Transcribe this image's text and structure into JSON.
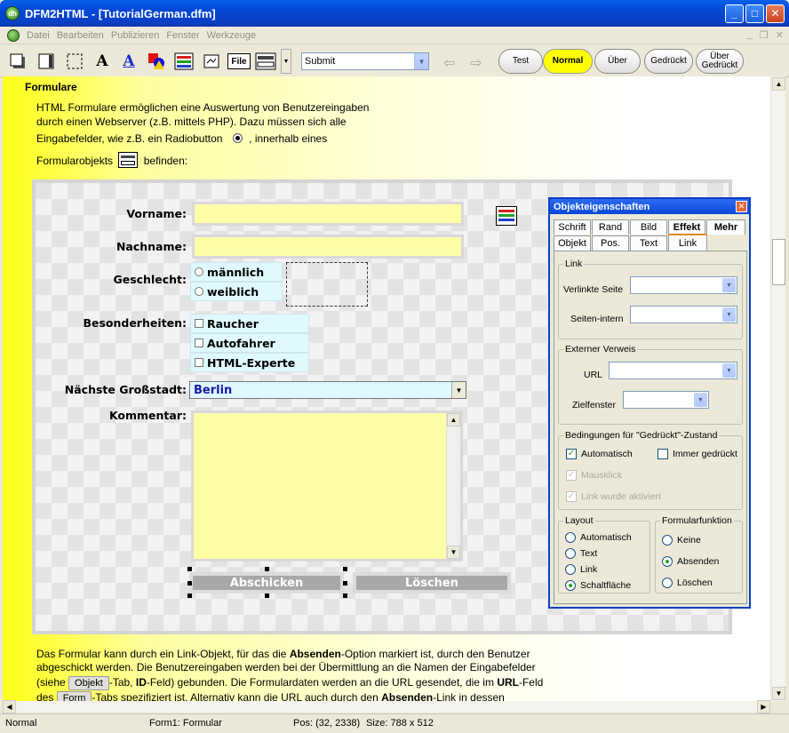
{
  "window": {
    "title": "DFM2HTML - [TutorialGerman.dfm]",
    "app_icon_label": "dh"
  },
  "menu": {
    "items": [
      "Datei",
      "Bearbeiten",
      "Publizieren",
      "Fenster",
      "Werkzeuge"
    ]
  },
  "toolbar": {
    "text_tool": "A",
    "text_tool_blue": "A",
    "file_label": "File",
    "combo_value": "Submit",
    "state_buttons": [
      "Test",
      "Normal",
      "Über",
      "Gedrückt",
      "Über Gedrückt"
    ]
  },
  "doc": {
    "heading": "Formulare",
    "intro_1": "HTML Formulare ermöglichen eine Auswertung von Benutzereingaben",
    "intro_2": "durch einen Webserver (z.B. mittels PHP). Dazu müssen sich alle",
    "intro_3a": "Eingabefelder, wie z.B. ein Radiobutton",
    "intro_3b": ", innerhalb eines",
    "intro_4a": "Formularobjekts",
    "intro_4b": "befinden:",
    "outro_1a": "Das Formular kann durch ein Link-Objekt, für das die",
    "outro_1b": "Absenden",
    "outro_1c": "-Option markiert ist, durch den Benutzer",
    "outro_2": "abgeschickt werden. Die Benutzereingaben werden bei der Übermittlung an die Namen der Eingabefelder",
    "outro_3a": "(siehe",
    "outro_3_btn": "Objekt",
    "outro_3b": "-Tab,",
    "outro_3c": "ID",
    "outro_3d": "-Feld) gebunden. Die Formulardaten werden an die URL gesendet, die im",
    "outro_3e": "URL",
    "outro_3f": "-Feld",
    "outro_4a": "des",
    "outro_4_btn": "Form",
    "outro_4b": "-Tabs spezifiziert ist. Alternativ kann die URL auch durch den",
    "outro_4c": "Absenden",
    "outro_4d": "-Link in dessen"
  },
  "form": {
    "vorname_label": "Vorname:",
    "nachname_label": "Nachname:",
    "geschlecht_label": "Geschlecht:",
    "radio_male": "männlich",
    "radio_female": "weiblich",
    "besonderheiten_label": "Besonderheiten:",
    "check_raucher": "Raucher",
    "check_autofahrer": "Autofahrer",
    "check_html": "HTML-Experte",
    "city_label": "Nächste Großstadt:",
    "city_value": "Berlin",
    "kommentar_label": "Kommentar:",
    "submit_label": "Abschicken",
    "reset_label": "Löschen"
  },
  "props": {
    "title": "Objekteigenschaften",
    "tabs_row1": [
      "Schrift",
      "Rand",
      "Bild",
      "Effekt",
      "Mehr"
    ],
    "tabs_row2": [
      "Objekt",
      "Pos.",
      "Text",
      "Link"
    ],
    "group_link": "Link",
    "verlinkte_seite": "Verlinkte Seite",
    "seiten_intern": "Seiten-intern",
    "group_extern": "Externer Verweis",
    "url": "URL",
    "zielfenster": "Zielfenster",
    "group_bedingungen": "Bedingungen für \"Gedrückt\"-Zustand",
    "automatisch": "Automatisch",
    "immer_gedrueckt": "Immer gedrückt",
    "mausklick": "Mausklick",
    "link_aktiviert": "Link wurde aktiviert",
    "group_layout": "Layout",
    "layout_options": [
      "Automatisch",
      "Text",
      "Link",
      "Schaltfläche"
    ],
    "group_formfunktion": "Formularfunktion",
    "form_options": [
      "Keine",
      "Absenden",
      "Löschen"
    ]
  },
  "status": {
    "mode": "Normal",
    "object": "Form1: Formular",
    "pos": "Pos: (32, 2338)",
    "size": "Size: 788 x 512"
  },
  "colors": {
    "title_bar": "#0a47d6",
    "page_yellow": "#ffff22",
    "field_yellow": "#ffffa8",
    "checkbox_cyan": "#dff9ff",
    "button_gray": "#a8a8a8",
    "normal_pill": "#ffff00"
  }
}
